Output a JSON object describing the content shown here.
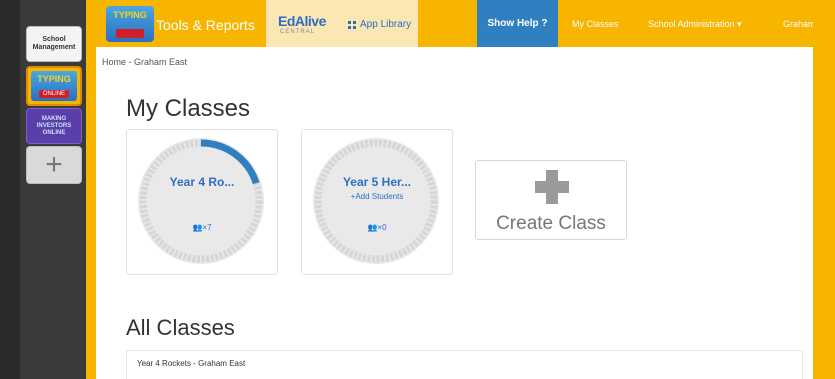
{
  "app_tiles": {
    "school_management": "School Management",
    "typing": {
      "title": "TYPING",
      "subtitle": "ONLINE"
    },
    "maths": "MAKING INVESTORS ONLINE",
    "add": "+"
  },
  "topbar": {
    "logo": {
      "title": "TYPING",
      "subtitle": "ONLINE"
    },
    "tools_reports": "Tools & Reports",
    "edalive_brand": "EdAlive",
    "edalive_sub": "CENTRAL",
    "app_library": "App Library",
    "show_help": "Show Help ?",
    "my_classes": "My Classes",
    "school_admin": "School Administration ▾",
    "user": "Graham ▾"
  },
  "breadcrumb": "Home - Graham East",
  "my_classes_heading": "My Classes",
  "classes": [
    {
      "title": "Year 4 Ro...",
      "subtitle": "",
      "count": "×7",
      "progress": 0.2
    },
    {
      "title": "Year 5 Her...",
      "subtitle": "+Add Students",
      "count": "×0",
      "progress": 0
    }
  ],
  "create_class": "Create Class",
  "all_classes_heading": "All Classes",
  "all_classes": [
    "Year 4 Rockets - Graham East"
  ],
  "colors": {
    "accent_orange": "#f7b500",
    "help_blue": "#2f7fc1",
    "link_blue": "#2f6ec4",
    "ring_track": "#d6d6d6",
    "ring_progress": "#2f7fc1"
  }
}
